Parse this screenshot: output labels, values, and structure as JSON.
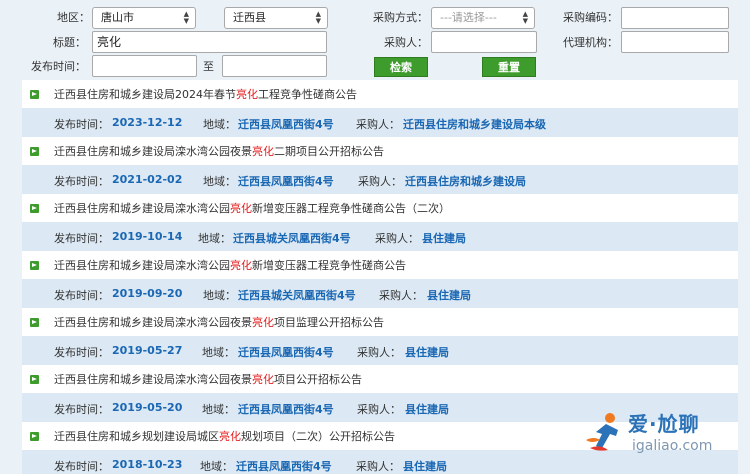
{
  "filters": {
    "region_label": "地区：",
    "city_value": "唐山市",
    "county_value": "迁西县",
    "method_label": "采购方式：",
    "method_value": "---请选择---",
    "code_label": "采购编码：",
    "code_value": "",
    "title_label": "标题：",
    "title_value": "亮化",
    "buyer_label": "采购人：",
    "buyer_value": "",
    "agency_label": "代理机构：",
    "agency_value": "",
    "date_label": "发布时间：",
    "date_from": "",
    "to_label": "至",
    "date_to": "",
    "search_button": "检索",
    "reset_button": "重置"
  },
  "labels": {
    "published": "发布时间：",
    "region": "地域：",
    "buyer": "采购人："
  },
  "results": [
    {
      "prefix": "迁西县住房和城乡建设局2024年春节",
      "highlight": "亮化",
      "suffix": "工程竞争性磋商公告",
      "date": "2023-12-12",
      "region": "迁西县凤凰西街4号",
      "buyer": "迁西县住房和城乡建设局本级"
    },
    {
      "prefix": "迁西县住房和城乡建设局滦水湾公园夜景",
      "highlight": "亮化",
      "suffix": "二期项目公开招标公告",
      "date": "2021-02-02",
      "region": "迁西县凤凰西街4号",
      "buyer": "迁西县住房和城乡建设局"
    },
    {
      "prefix": "迁西县住房和城乡建设局滦水湾公园",
      "highlight": "亮化",
      "suffix": "新增变压器工程竞争性磋商公告（二次）",
      "date": "2019-10-14",
      "region": "迁西县城关凤凰西街4号",
      "buyer": "县住建局"
    },
    {
      "prefix": "迁西县住房和城乡建设局滦水湾公园",
      "highlight": "亮化",
      "suffix": "新增变压器工程竞争性磋商公告",
      "date": "2019-09-20",
      "region": "迁西县城关凤凰西街4号",
      "buyer": "县住建局"
    },
    {
      "prefix": "迁西县住房和城乡建设局滦水湾公园夜景",
      "highlight": "亮化",
      "suffix": "项目监理公开招标公告",
      "date": "2019-05-27",
      "region": "迁西县凤凰西街4号",
      "buyer": "县住建局"
    },
    {
      "prefix": "迁西县住房和城乡建设局滦水湾公园夜景",
      "highlight": "亮化",
      "suffix": "项目公开招标公告",
      "date": "2019-05-20",
      "region": "迁西县凤凰西街4号",
      "buyer": "县住建局"
    },
    {
      "prefix": "迁西县住房和城乡规划建设局城区",
      "highlight": "亮化",
      "suffix": "规划项目（二次）公开招标公告",
      "date": "2018-10-23",
      "region": "迁西县凤凰西街4号",
      "buyer": "县住建局"
    }
  ],
  "watermark": {
    "brand": "爱·尬聊",
    "domain": "igaliao.com"
  }
}
